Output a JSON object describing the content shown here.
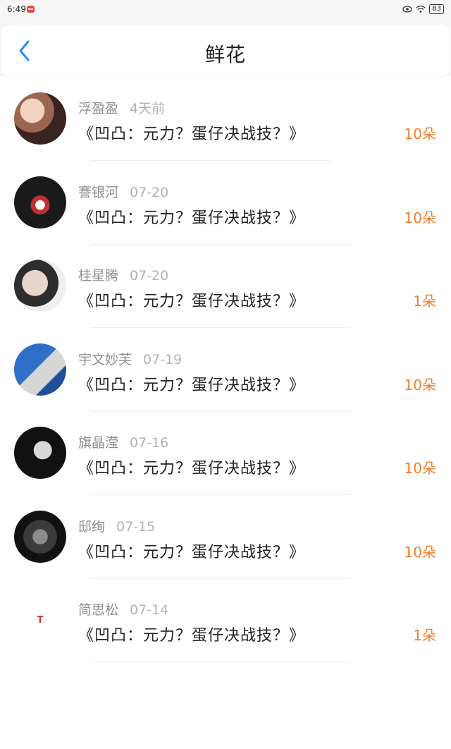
{
  "status_bar": {
    "time": "6:49",
    "battery": "83",
    "icons": [
      "notification-icon",
      "eye-icon",
      "wifi-icon",
      "battery-icon"
    ]
  },
  "header": {
    "title": "鲜花",
    "back_icon": "chevron-left-icon",
    "accent_color": "#2a8df2"
  },
  "items": [
    {
      "name": "浮盈盈",
      "date": "4天前",
      "message": "《凹凸：元力？蛋仔决战技？》",
      "count": "10朵"
    },
    {
      "name": "謇银河",
      "date": "07-20",
      "message": "《凹凸：元力？蛋仔决战技？》",
      "count": "10朵"
    },
    {
      "name": "桂星腾",
      "date": "07-20",
      "message": "《凹凸：元力？蛋仔决战技？》",
      "count": "1朵"
    },
    {
      "name": "宇文妙芙",
      "date": "07-19",
      "message": "《凹凸：元力？蛋仔决战技？》",
      "count": "10朵"
    },
    {
      "name": "旗晶滢",
      "date": "07-16",
      "message": "《凹凸：元力？蛋仔决战技？》",
      "count": "10朵"
    },
    {
      "name": "邸绚",
      "date": "07-15",
      "message": "《凹凸：元力？蛋仔决战技？》",
      "count": "10朵"
    },
    {
      "name": "简思松",
      "date": "07-14",
      "message": "《凹凸：元力？蛋仔决战技？》",
      "count": "1朵"
    },
    {
      "name": "",
      "date": "",
      "message": "",
      "count": ""
    }
  ],
  "colors": {
    "count": "#f07f2d",
    "name": "#8f8f8f",
    "date": "#b2b2b2"
  }
}
